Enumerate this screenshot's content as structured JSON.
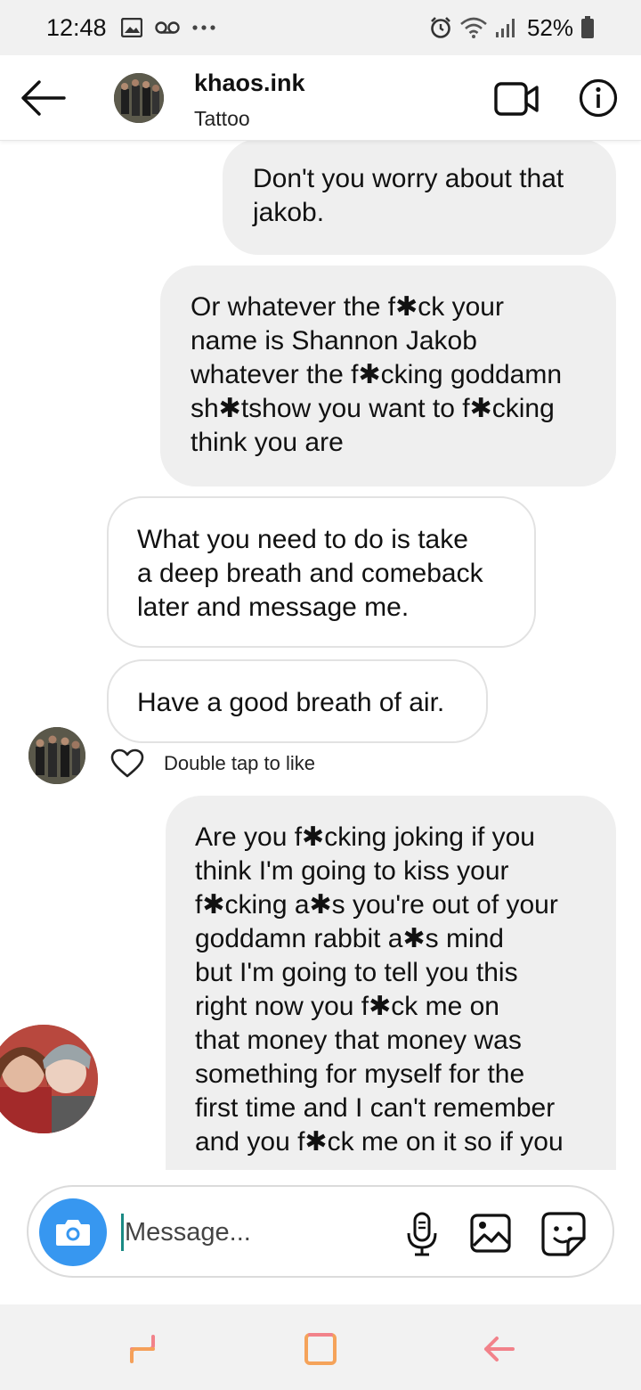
{
  "status_bar": {
    "time": "12:48",
    "battery_percent": "52%",
    "left_icons": [
      "image-icon",
      "voicemail-icon",
      "more-dots-icon"
    ],
    "right_icons": [
      "alarm-icon",
      "wifi-icon",
      "signal-icon",
      "battery-icon"
    ]
  },
  "header": {
    "username": "khaos.ink",
    "subtitle": "Tattoo"
  },
  "messages": [
    {
      "from": "me",
      "lines": [
        "Don't you worry about that",
        "jakob."
      ]
    },
    {
      "from": "me",
      "lines": [
        "Or whatever the f✱ck your",
        "name is Shannon Jakob",
        "whatever the f✱cking goddamn",
        "sh✱tshow you want to f✱cking",
        "think you are"
      ]
    },
    {
      "from": "them",
      "lines": [
        "What you need to do is take",
        "a deep breath and comeback",
        "later and message me."
      ]
    },
    {
      "from": "them",
      "lines": [
        "Have a good breath of air."
      ]
    },
    {
      "from": "me",
      "lines": [
        "Are you f✱cking joking if you",
        "think I'm going to kiss your",
        "f✱cking a✱s you're out of your",
        "goddamn rabbit a✱s mind",
        "but I'm going to tell you this",
        "right now you f✱ck me on",
        "that money that money was",
        "something for myself for the",
        "first time and I can't remember",
        "and you f✱ck me on it so if you"
      ]
    }
  ],
  "like_hint": "Double tap to like",
  "composer": {
    "placeholder": "Message..."
  },
  "colors": {
    "accent_blue": "#3797f0",
    "sent_bubble": "#efefef",
    "nav_icon": "#f08a8a"
  }
}
